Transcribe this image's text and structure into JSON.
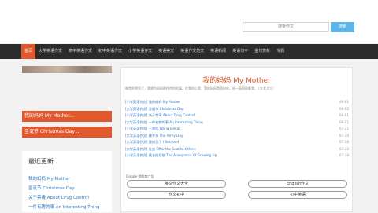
{
  "search": {
    "placeholder": "搜索作文",
    "button_label": "搜索"
  },
  "nav": [
    {
      "label": "首页",
      "active": true
    },
    {
      "label": "大学英语作文"
    },
    {
      "label": "高中英语作文"
    },
    {
      "label": "初中英语作文"
    },
    {
      "label": "小学英语作文"
    },
    {
      "label": "英语美文"
    },
    {
      "label": "英语作文范文"
    },
    {
      "label": "英语新闻"
    },
    {
      "label": "英语句子"
    },
    {
      "label": "金句赏析"
    },
    {
      "label": "专题"
    }
  ],
  "sidebar": {
    "link_1": "我的妈妈 My Mother...",
    "link_2": "圣诞节 Christmas Day ...",
    "recent_title": "最近更新",
    "recent": [
      "我的妈妈 My Mother",
      "圣诞节 Christmas Day",
      "关于禁毒 About Drug Control",
      "一件有趣的事 An Interesting Thing"
    ]
  },
  "article": {
    "title": "我的妈妈 My Mother",
    "intro": "每首节哭到了，我想为妈妈做件特别的事。在我的心里，我的妈妈是很好的，给一直照顾着我。",
    "intro_more": "[查看全文]",
    "list": [
      {
        "cat": "[小学英语作文]",
        "title": "我的妈妈 My Mother",
        "date": "08-01"
      },
      {
        "cat": "[大学英语作文]",
        "title": "圣诞节 Christmas Day",
        "date": "08-02"
      },
      {
        "cat": "[小学英语作文]",
        "title": "关于禁毒 About Drug Control",
        "date": "08-01"
      },
      {
        "cat": "[大学英语作文]",
        "title": "一件有趣的事 An Interesting Thing",
        "date": "08-01"
      },
      {
        "cat": "[小学英语作文]",
        "title": "王俊凯 Wang Junkai",
        "date": "07-31"
      },
      {
        "cat": "[大学英语作文]",
        "title": "建军节 The Army Day",
        "date": "07-30"
      },
      {
        "cat": "[大学英语作文]",
        "title": "我成功了 I Succeed",
        "date": "07-28"
      },
      {
        "cat": "[大学英语作文]",
        "title": "让座 Offer the Seat to Others",
        "date": "07-28"
      },
      {
        "cat": "[小学英语作文]",
        "title": "成长的烦恼 The Annoyance Of Growing Up",
        "date": "07-28"
      }
    ],
    "ad_label": "Google 赞助商广告",
    "pills": [
      "英文作文大全",
      "English作文",
      "作文初中",
      "初中英语"
    ]
  }
}
